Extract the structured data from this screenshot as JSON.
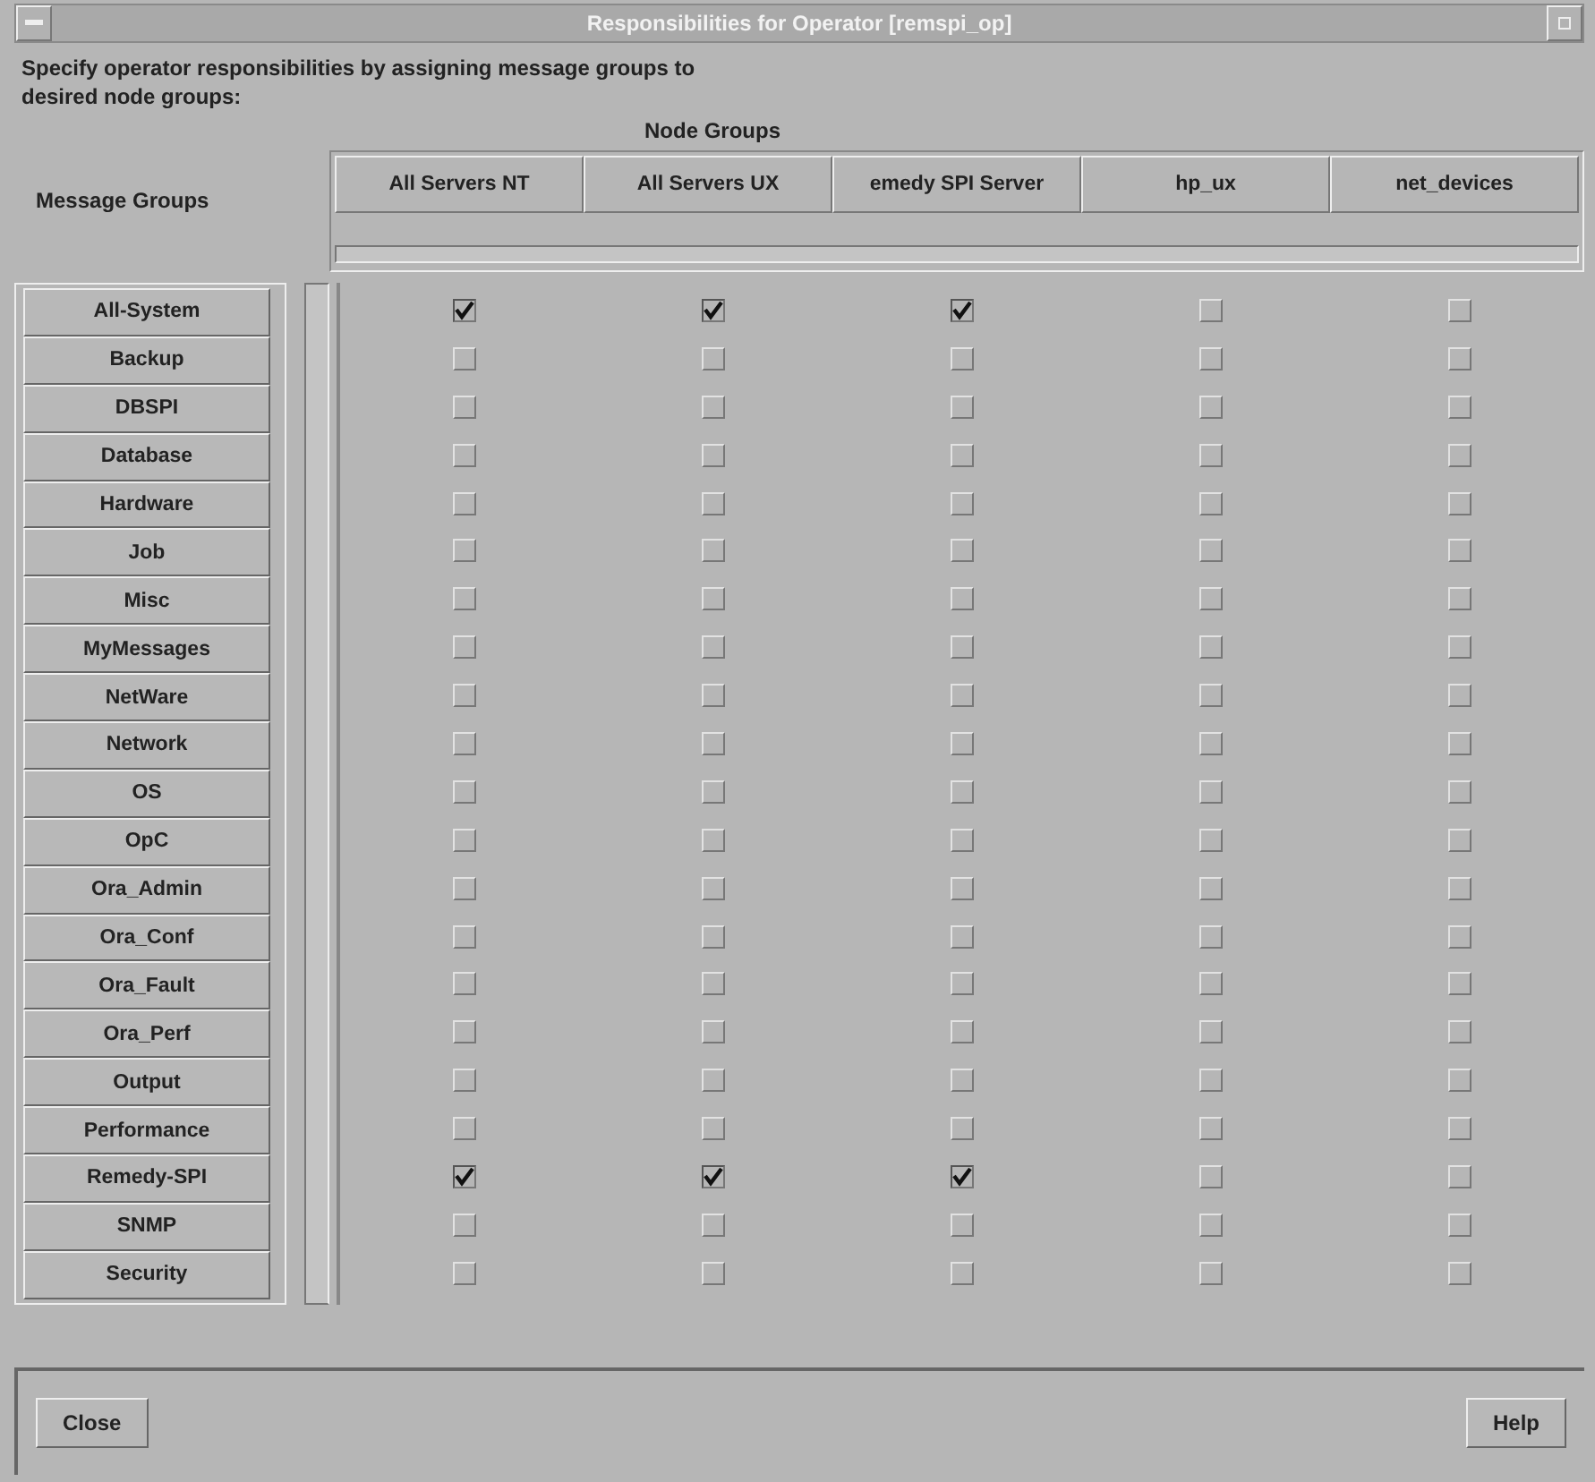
{
  "window": {
    "title": "Responsibilities for Operator [remspi_op]"
  },
  "instructions": "Specify operator responsibilities by assigning message groups to desired node groups:",
  "node_groups_label": "Node Groups",
  "message_groups_label": "Message Groups",
  "columns": [
    "All Servers NT",
    "All Servers UX",
    "emedy SPI Server",
    "hp_ux",
    "net_devices"
  ],
  "rows": [
    {
      "group": "All-System",
      "checks": [
        true,
        true,
        true,
        false,
        false
      ]
    },
    {
      "group": "Backup",
      "checks": [
        false,
        false,
        false,
        false,
        false
      ]
    },
    {
      "group": "DBSPI",
      "checks": [
        false,
        false,
        false,
        false,
        false
      ]
    },
    {
      "group": "Database",
      "checks": [
        false,
        false,
        false,
        false,
        false
      ]
    },
    {
      "group": "Hardware",
      "checks": [
        false,
        false,
        false,
        false,
        false
      ]
    },
    {
      "group": "Job",
      "checks": [
        false,
        false,
        false,
        false,
        false
      ]
    },
    {
      "group": "Misc",
      "checks": [
        false,
        false,
        false,
        false,
        false
      ]
    },
    {
      "group": "MyMessages",
      "checks": [
        false,
        false,
        false,
        false,
        false
      ]
    },
    {
      "group": "NetWare",
      "checks": [
        false,
        false,
        false,
        false,
        false
      ]
    },
    {
      "group": "Network",
      "checks": [
        false,
        false,
        false,
        false,
        false
      ]
    },
    {
      "group": "OS",
      "checks": [
        false,
        false,
        false,
        false,
        false
      ]
    },
    {
      "group": "OpC",
      "checks": [
        false,
        false,
        false,
        false,
        false
      ]
    },
    {
      "group": "Ora_Admin",
      "checks": [
        false,
        false,
        false,
        false,
        false
      ]
    },
    {
      "group": "Ora_Conf",
      "checks": [
        false,
        false,
        false,
        false,
        false
      ]
    },
    {
      "group": "Ora_Fault",
      "checks": [
        false,
        false,
        false,
        false,
        false
      ]
    },
    {
      "group": "Ora_Perf",
      "checks": [
        false,
        false,
        false,
        false,
        false
      ]
    },
    {
      "group": "Output",
      "checks": [
        false,
        false,
        false,
        false,
        false
      ]
    },
    {
      "group": "Performance",
      "checks": [
        false,
        false,
        false,
        false,
        false
      ]
    },
    {
      "group": "Remedy-SPI",
      "checks": [
        true,
        true,
        true,
        false,
        false
      ]
    },
    {
      "group": "SNMP",
      "checks": [
        false,
        false,
        false,
        false,
        false
      ]
    },
    {
      "group": "Security",
      "checks": [
        false,
        false,
        false,
        false,
        false
      ]
    }
  ],
  "buttons": [
    "Close",
    "Help"
  ]
}
